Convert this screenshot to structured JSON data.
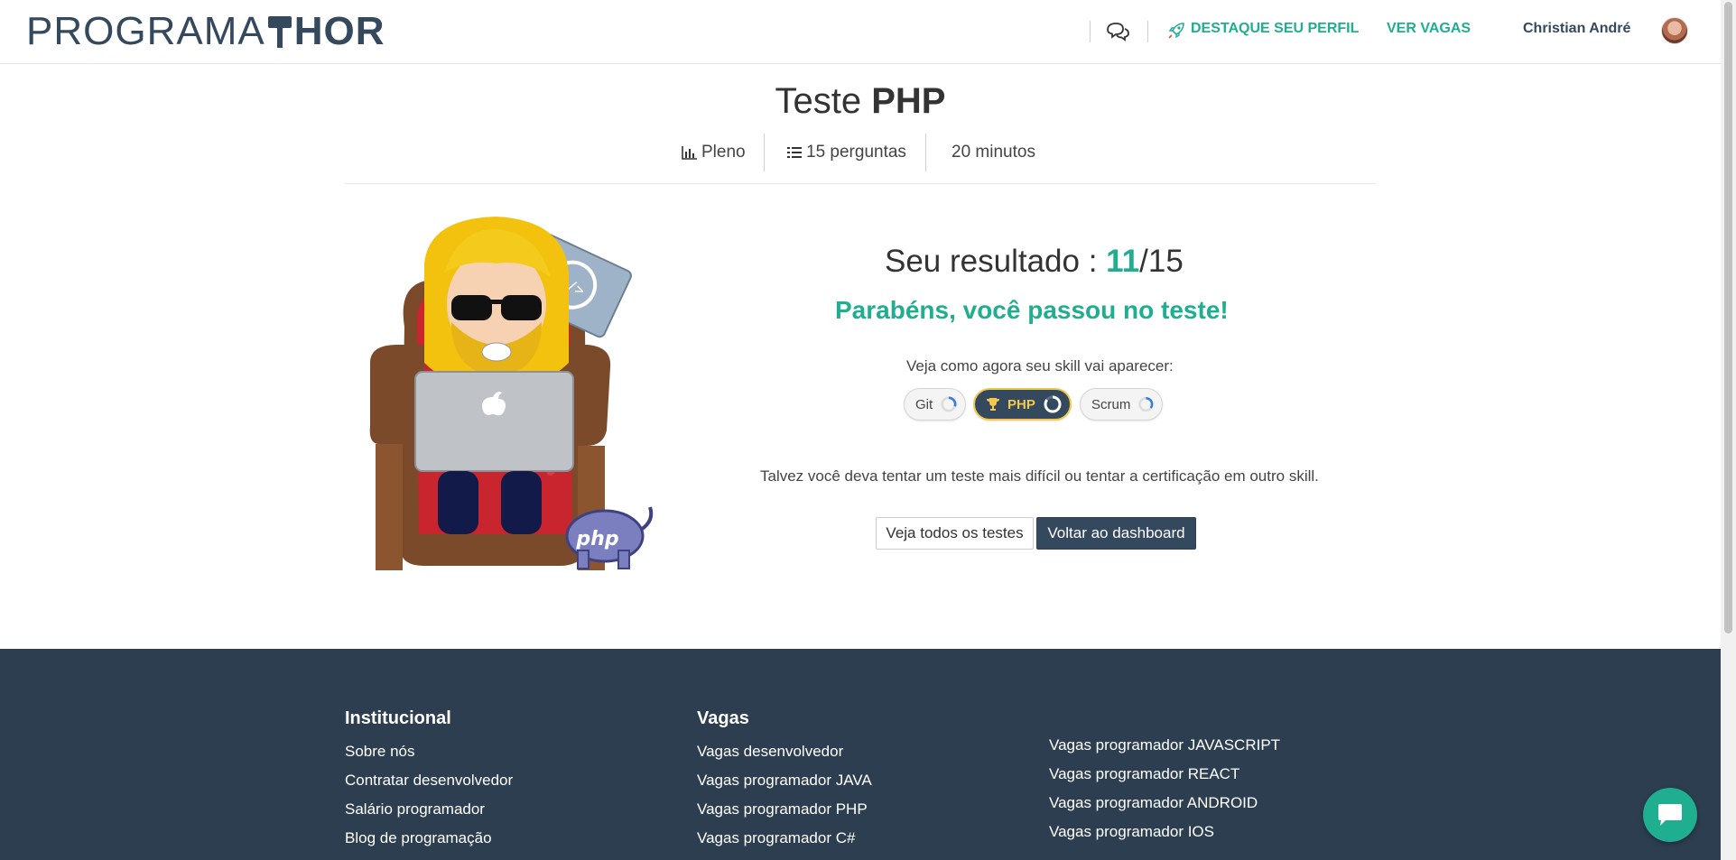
{
  "header": {
    "logo_left": "PROGRAMA",
    "logo_right": "HOR",
    "highlight_profile": "DESTAQUE SEU PERFIL",
    "see_jobs": "VER VAGAS",
    "user_name": "Christian André"
  },
  "test": {
    "title_prefix": "Teste",
    "title_skill": "PHP",
    "level": "Pleno",
    "questions": "15 perguntas",
    "duration": "20 minutos"
  },
  "result": {
    "label": "Seu resultado :",
    "score": "11",
    "total": "/15",
    "pass_message": "Parabéns, você passou no teste!",
    "preview_label": "Veja como agora seu skill vai aparecer:",
    "skills": [
      {
        "name": "Git",
        "active": false,
        "progress": 0.3
      },
      {
        "name": "PHP",
        "active": true,
        "progress": 0.85
      },
      {
        "name": "Scrum",
        "active": false,
        "progress": 0.35
      }
    ],
    "suggestion": "Talvez você deva tentar um teste mais difícil ou tentar a certificação em outro skill.",
    "btn_all_tests": "Veja todos os testes",
    "btn_dashboard": "Voltar ao dashboard"
  },
  "illustration": {
    "badge_text": "php"
  },
  "footer": {
    "col1_title": "Institucional",
    "col1_links": [
      "Sobre nós",
      "Contratar desenvolvedor",
      "Salário programador",
      "Blog de programação"
    ],
    "col2_title": "Vagas",
    "col2_links": [
      "Vagas desenvolvedor",
      "Vagas programador JAVA",
      "Vagas programador PHP",
      "Vagas programador C#"
    ],
    "col3_links": [
      "Vagas programador JAVASCRIPT",
      "Vagas programador REACT",
      "Vagas programador ANDROID",
      "Vagas programador IOS"
    ]
  },
  "colors": {
    "accent": "#1fae8f",
    "dark": "#34495e",
    "footer_bg": "#2c3e50",
    "gold": "#f0c94a"
  }
}
